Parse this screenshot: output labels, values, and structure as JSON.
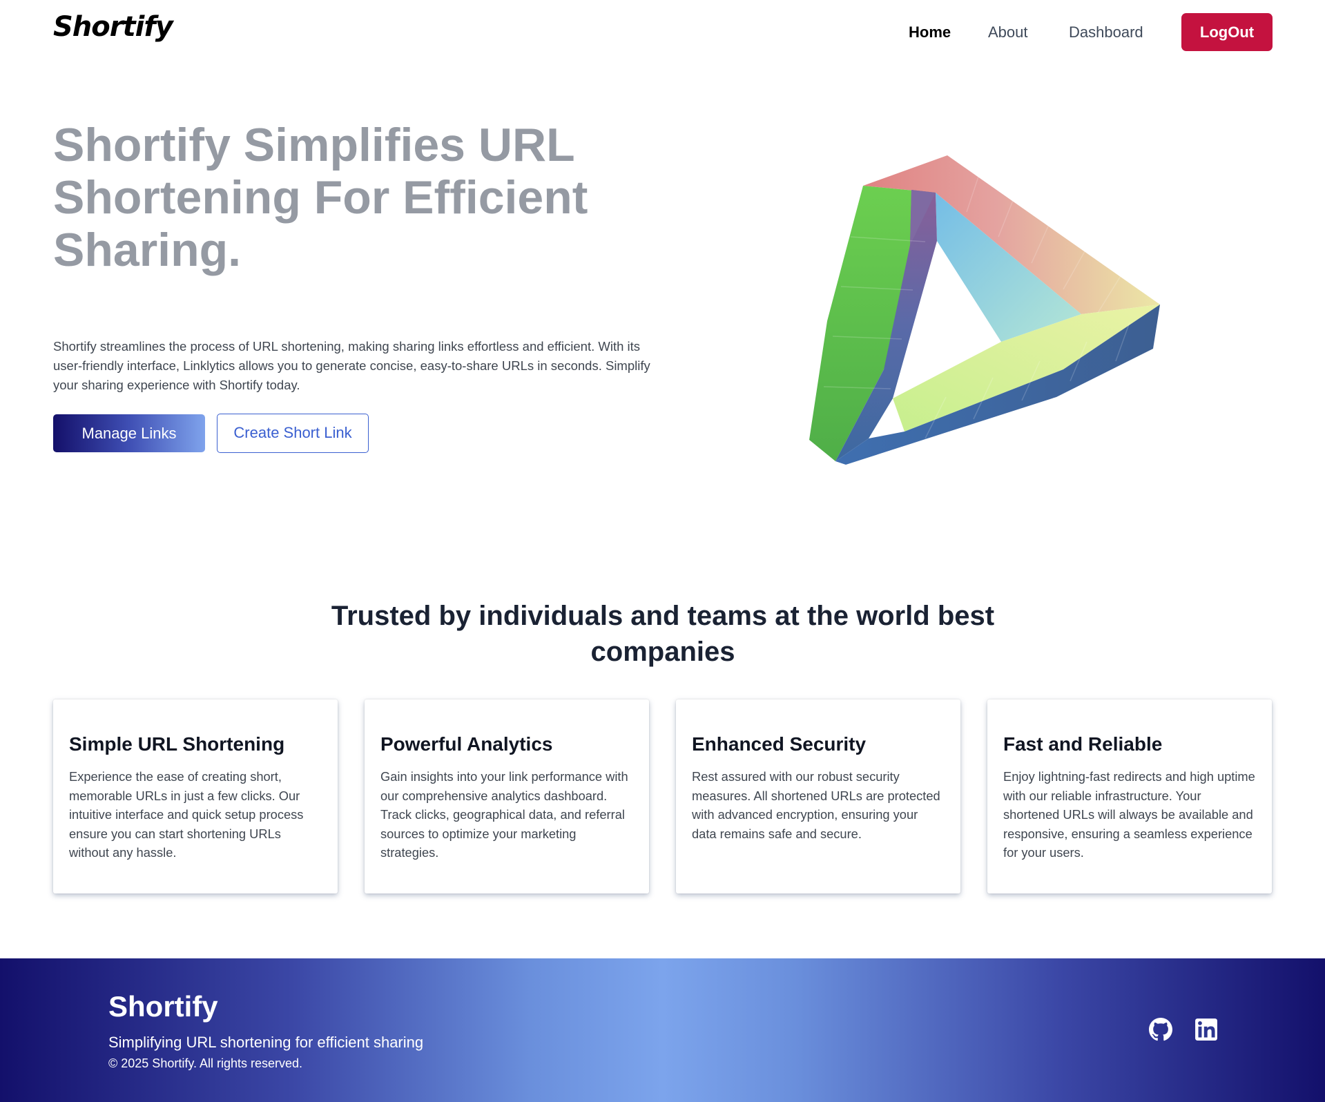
{
  "navbar": {
    "logo": "Shortify",
    "links": [
      {
        "label": "Home"
      },
      {
        "label": "About"
      },
      {
        "label": "Dashboard"
      }
    ],
    "logout_label": "LogOut"
  },
  "hero": {
    "title": "Shortify Simplifies URL Shortening For Efficient Sharing.",
    "description": "Shortify streamlines the process of URL shortening, making sharing links effortless and efficient. With its user-friendly interface, Linklytics allows you to generate concise, easy-to-share URLs in seconds. Simplify your sharing experience with Shortify today.",
    "primary_button": "Manage Links",
    "secondary_button": "Create Short Link"
  },
  "trusted": {
    "heading": "Trusted by individuals and teams at the world best companies"
  },
  "features": [
    {
      "title": "Simple URL Shortening",
      "text": "Experience the ease of creating short, memorable URLs in just a few clicks. Our intuitive interface and quick setup process ensure you can start shortening URLs without any hassle."
    },
    {
      "title": "Powerful Analytics",
      "text": "Gain insights into your link performance with our comprehensive analytics dashboard. Track clicks, geographical data, and referral sources to optimize your marketing strategies."
    },
    {
      "title": "Enhanced Security",
      "text": "Rest assured with our robust security measures. All shortened URLs are protected with advanced encryption, ensuring your data remains safe and secure."
    },
    {
      "title": "Fast and Reliable",
      "text": "Enjoy lightning-fast redirects and high uptime with our reliable infrastructure. Your shortened URLs will always be available and responsive, ensuring a seamless experience for your users."
    }
  ],
  "footer": {
    "brand": "Shortify",
    "tagline": "Simplifying URL shortening for efficient sharing",
    "copyright": "© 2025 Shortify. All rights reserved.",
    "social": [
      "github-icon",
      "linkedin-icon"
    ]
  },
  "colors": {
    "logout": "#c4123f",
    "gradient_dark": "#13106b",
    "gradient_light": "#7ca4ec",
    "outline_blue": "#3a5fd0"
  }
}
